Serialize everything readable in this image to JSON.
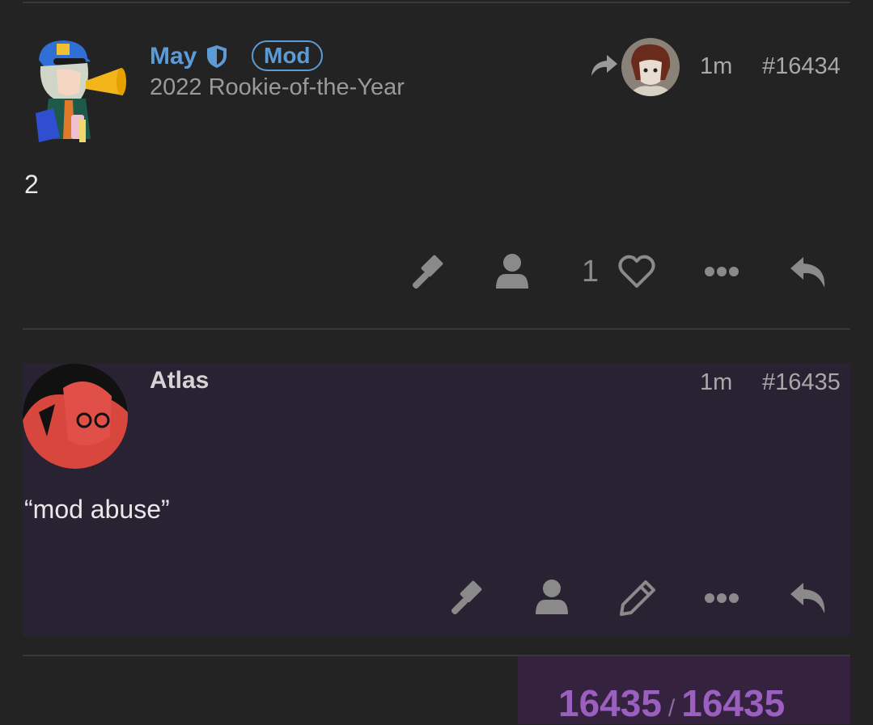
{
  "posts": [
    {
      "author": "May",
      "badge": "Mod",
      "subtitle": "2022 Rookie-of-the-Year",
      "time": "1m",
      "number": "#16434",
      "body": "2",
      "like_count": "1",
      "icons": [
        "shield-icon",
        "share-icon",
        "gavel-icon",
        "user-icon",
        "heart-icon",
        "more-icon",
        "reply-icon"
      ]
    },
    {
      "author": "Atlas",
      "time": "1m",
      "number": "#16435",
      "body": "“mod abuse”",
      "icons": [
        "gavel-icon",
        "user-icon",
        "pencil-icon",
        "more-icon",
        "reply-icon"
      ]
    }
  ],
  "progress": {
    "current": "16435",
    "separator": "/",
    "total": "16435"
  },
  "colors": {
    "background": "#232323",
    "mod_blue": "#5d9bd6",
    "highlight_post": "#292233",
    "progress_bg": "#35223f",
    "progress_text": "#9b5fc0"
  }
}
